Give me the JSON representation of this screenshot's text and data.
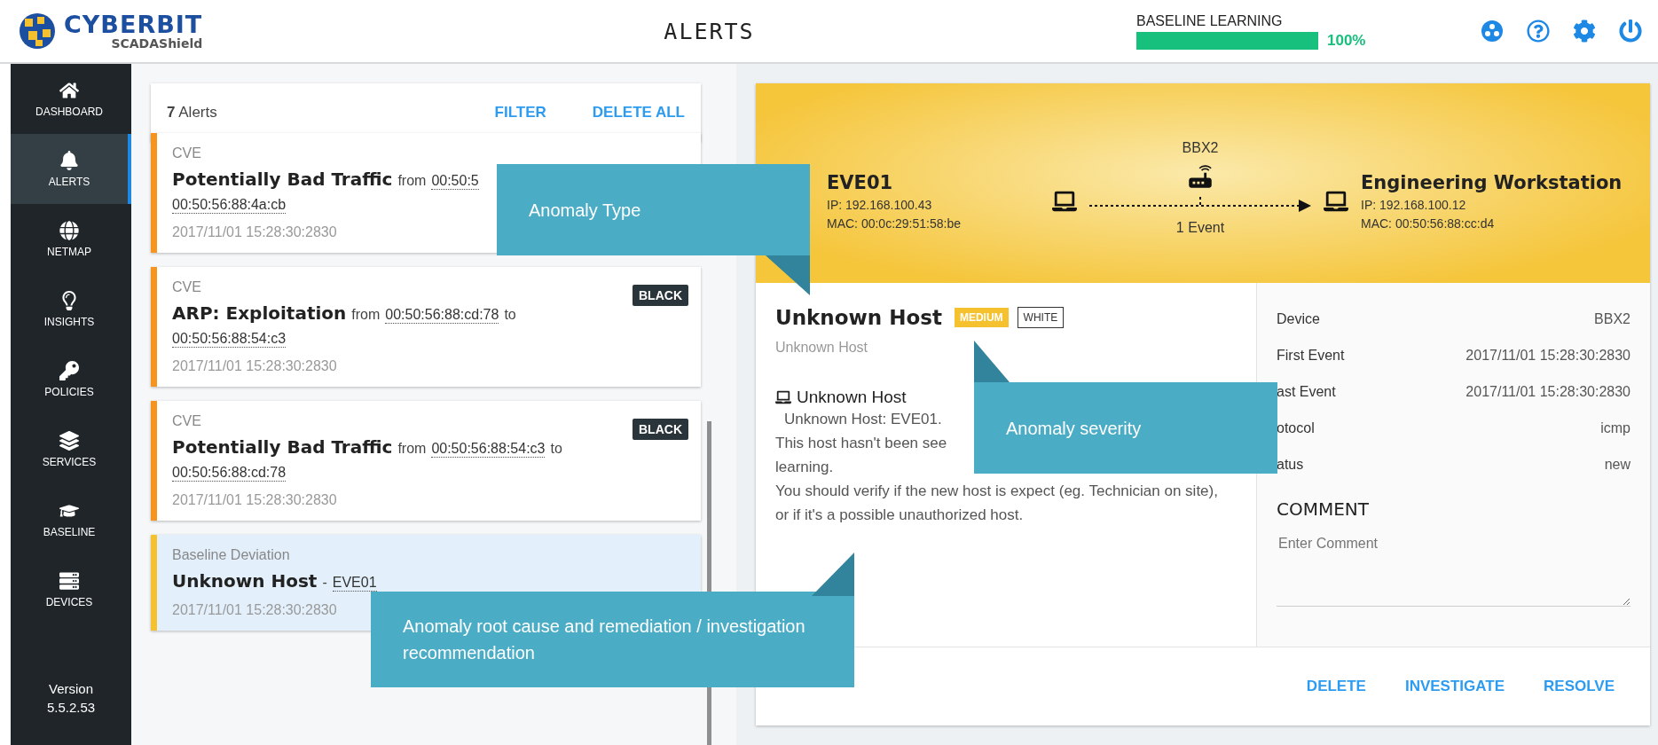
{
  "header": {
    "brand": "CYBERBIT",
    "product": "SCADAShield",
    "title": "ALERTS",
    "baseline": {
      "label": "BASELINE LEARNING",
      "level": 1,
      "reading": "100%"
    }
  },
  "nav": {
    "items": [
      {
        "label": "DASHBOARD",
        "selected": false
      },
      {
        "label": "ALERTS",
        "selected": true
      },
      {
        "label": "NETMAP",
        "selected": false
      },
      {
        "label": "INSIGHTS",
        "selected": false
      },
      {
        "label": "POLICIES",
        "selected": false
      },
      {
        "label": "SERVICES",
        "selected": false
      },
      {
        "label": "BASELINE",
        "selected": false
      },
      {
        "label": "DEVICES",
        "selected": false
      }
    ],
    "version": "Version",
    "version_number": "5.5.2.53"
  },
  "alerts": {
    "count": "7",
    "count_label": "Alerts",
    "actions": [
      "FILTER",
      "DELETE ALL"
    ],
    "items": [
      {
        "category": "CVE",
        "color": "#f7941d",
        "selected": false,
        "lines": [
          [
            {
              "kind": "title",
              "text": "Potentially Bad Traffic"
            },
            {
              "kind": "text",
              "text": "from"
            },
            {
              "kind": "address",
              "text": "00:50:5"
            }
          ],
          [
            {
              "kind": "address",
              "text": "00:50:56:88:4a:cb"
            }
          ]
        ],
        "time": "2017/11/01 15:28:30:2830"
      },
      {
        "category": "CVE",
        "color": "#f7941d",
        "selected": false,
        "tag": "BLACK",
        "lines": [
          [
            {
              "kind": "title",
              "text": "ARP: Exploitation"
            },
            {
              "kind": "text",
              "text": "from"
            },
            {
              "kind": "address",
              "text": "00:50:56:88:cd:78"
            },
            {
              "kind": "text",
              "text": "to"
            }
          ],
          [
            {
              "kind": "address",
              "text": "00:50:56:88:54:c3"
            }
          ]
        ],
        "time": "2017/11/01 15:28:30:2830"
      },
      {
        "category": "CVE",
        "color": "#f7941d",
        "selected": false,
        "tag": "BLACK",
        "lines": [
          [
            {
              "kind": "title",
              "text": "Potentially Bad Traffic"
            },
            {
              "kind": "text",
              "text": "from"
            },
            {
              "kind": "address",
              "text": "00:50:56:88:54:c3"
            },
            {
              "kind": "text",
              "text": "to"
            }
          ],
          [
            {
              "kind": "address",
              "text": "00:50:56:88:cd:78"
            }
          ]
        ],
        "time": "2017/11/01 15:28:30:2830"
      },
      {
        "category": "Baseline Deviation",
        "color": "#f5c12e",
        "selected": true,
        "lines": [
          [
            {
              "kind": "title",
              "text": "Unknown Host"
            },
            {
              "kind": "text",
              "text": "-"
            },
            {
              "kind": "address",
              "text": "EVE01"
            }
          ]
        ],
        "time": "2017/11/01 15:28:30:2830"
      }
    ]
  },
  "detail": {
    "flow": {
      "source": {
        "name": "EVE01",
        "ip": "IP: 192.168.100.43",
        "mac": "MAC: 00:0c:29:51:58:be"
      },
      "device": "BBX2",
      "events": "1 Event",
      "target": {
        "name": "Engineering Workstation",
        "ip": "IP: 192.168.100.12",
        "mac": "MAC: 00:50:56:88:cc:d4"
      }
    },
    "title": "Unknown Host",
    "badges": [
      {
        "text": "MEDIUM",
        "kind": "filled"
      },
      {
        "text": "WHITE",
        "kind": "outline"
      }
    ],
    "subtitle": "Unknown Host",
    "description": {
      "heading": "Unknown Host",
      "lead": "Unknown Host: EVE01.",
      "lines": [
        "This host hasn't been see",
        "learning.",
        "You should verify if the new host is expect (eg. Technician on site), or if it's a possible unauthorized host."
      ]
    },
    "properties": [
      {
        "label": "Device",
        "value": "BBX2"
      },
      {
        "label": "First Event",
        "value": "2017/11/01 15:28:30:2830"
      },
      {
        "label": "ast Event",
        "value": "2017/11/01 15:28:30:2830"
      },
      {
        "label": "otocol",
        "value": "icmp"
      },
      {
        "label": "atus",
        "value": "new"
      }
    ],
    "comment": {
      "heading": "COMMENT",
      "placeholder": "Enter Comment"
    },
    "actions": [
      "DELETE",
      "INVESTIGATE",
      "RESOLVE"
    ]
  },
  "callouts": [
    {
      "text": "Anomaly Type"
    },
    {
      "text": "Anomaly severity"
    },
    {
      "text": "Anomaly root cause and remediation / investigation recommendation"
    }
  ]
}
